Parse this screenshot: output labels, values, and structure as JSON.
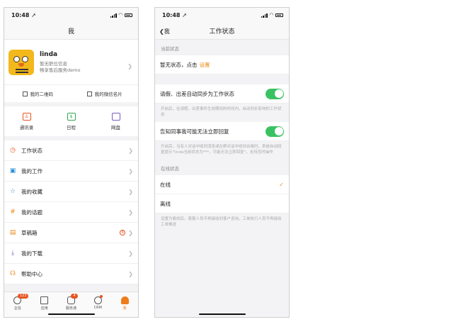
{
  "left": {
    "time": "10:48 ➚",
    "title": "我",
    "profile": {
      "name": "linda",
      "position": "暂无职位信息",
      "org": "畅享售后服务demo"
    },
    "qr_label": "我的二维码",
    "card_label": "我的微信名片",
    "quick": [
      {
        "label": "通讯录",
        "icon": "contacts-icon",
        "color": "#e9541e"
      },
      {
        "label": "日程",
        "icon": "calendar-icon",
        "color": "#2fa84f"
      },
      {
        "label": "网盘",
        "icon": "disk-icon",
        "color": "#7b5cc4"
      }
    ],
    "menu": [
      {
        "label": "工作状态",
        "icon": "clock-icon",
        "glyph": "◷",
        "color": "#e9541e"
      },
      {
        "label": "我的工作",
        "icon": "work-icon",
        "glyph": "▣",
        "color": "#2b8fd6"
      },
      {
        "label": "我的收藏",
        "icon": "star-icon",
        "glyph": "☆",
        "color": "#2b8fd6"
      },
      {
        "label": "我的话题",
        "icon": "hash-icon",
        "glyph": "#",
        "color": "#ee8a1a"
      },
      {
        "label": "草稿箱",
        "icon": "draft-icon",
        "glyph": "▤",
        "color": "#ee8a1a",
        "badge": "6"
      },
      {
        "label": "我的下载",
        "icon": "download-icon",
        "glyph": "⤓",
        "color": "#7b5cc4"
      },
      {
        "label": "帮助中心",
        "icon": "headset-icon",
        "glyph": "☊",
        "color": "#ee8a1a"
      }
    ],
    "tabs": [
      {
        "label": "企信",
        "icon": "chat-icon",
        "badge": "123"
      },
      {
        "label": "应用",
        "icon": "apps-icon"
      },
      {
        "label": "服务通",
        "icon": "service-icon",
        "badge": "4"
      },
      {
        "label": "CRM",
        "icon": "crm-icon",
        "dot": true
      },
      {
        "label": "我",
        "icon": "me-icon",
        "active": true
      }
    ]
  },
  "right": {
    "time": "10:48 ➚",
    "back_label": "我",
    "title": "工作状态",
    "current_section": "当前状态",
    "current_text": "暂无状态，点击",
    "current_link": "设置",
    "sync_label": "请假、出差自动同步为工作状态",
    "sync_desc": "开启后，在请假、出差事件生效期间的时间内，自动同步影响的工作状态",
    "notify_label": "告知同事我可能无法立即回复",
    "notify_desc": "开启后，当有人对话中收到消息或在群对话中收到合格时，系统自动回复提示\"linda当前状态为***，可能无法立即回复\"，支持否时操作",
    "online_section": "在线状态",
    "online_options": [
      {
        "label": "在线",
        "selected": true
      },
      {
        "label": "离线",
        "selected": false
      }
    ],
    "offline_desc": "设置为离线后，客服人员不再接收到客户咨询，工单执行人员不再接收工单推送"
  },
  "colors": {
    "accent": "#ee8a1a",
    "toggle_on": "#3ac262",
    "badge": "#e9541e"
  }
}
